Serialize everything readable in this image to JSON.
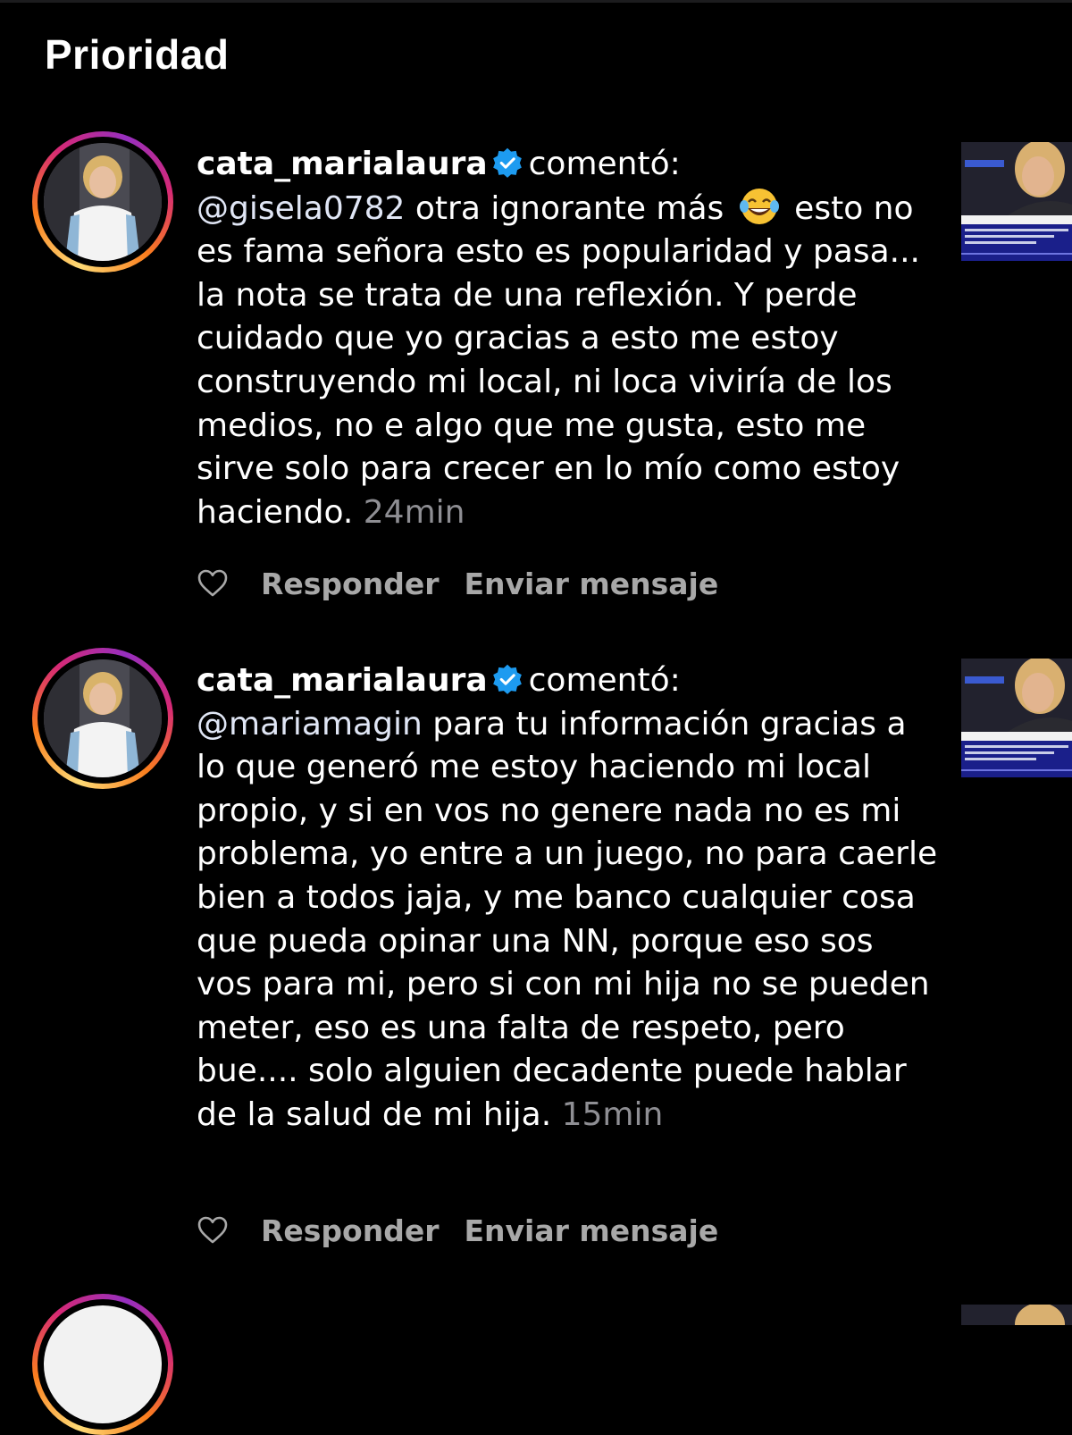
{
  "header": {
    "title": "Prioridad"
  },
  "notifications": [
    {
      "username": "cata_marialaura",
      "action": "comentó:",
      "mention": "@gisela0782",
      "text_before_emoji": " otra ignorante más ",
      "emoji": "joy-emoji",
      "text": " esto no es fama señora esto es popularidad y pasa... la nota se trata de una reflexión. Y perde cuidado que yo gracias a esto me estoy construyendo mi local, ni loca viviría de los medios, no e algo que me gusta, esto me sirve solo para crecer en lo mío como estoy haciendo.",
      "time": "24min",
      "reply_label": "Responder",
      "message_label": "Enviar mensaje"
    },
    {
      "username": "cata_marialaura",
      "action": "comentó:",
      "mention": "@mariamagin",
      "text": " para tu información gracias a lo que generó me estoy haciendo mi local propio, y si en vos no genere nada no es mi problema, yo entre a un juego, no para caerle bien a todos jaja, y me banco cualquier cosa que pueda opinar una NN, porque eso sos vos para mi, pero si con mi hija no se pueden meter, eso es una falta de respeto, pero bue.... solo alguien decadente puede hablar de la salud de mi hija.",
      "time": "15min",
      "reply_label": "Responder",
      "message_label": "Enviar mensaje"
    }
  ],
  "colors": {
    "background": "#000000",
    "text": "#ffffff",
    "secondary": "#8e8e93",
    "action": "#a8a8a8",
    "verified": "#1d9bf0"
  }
}
